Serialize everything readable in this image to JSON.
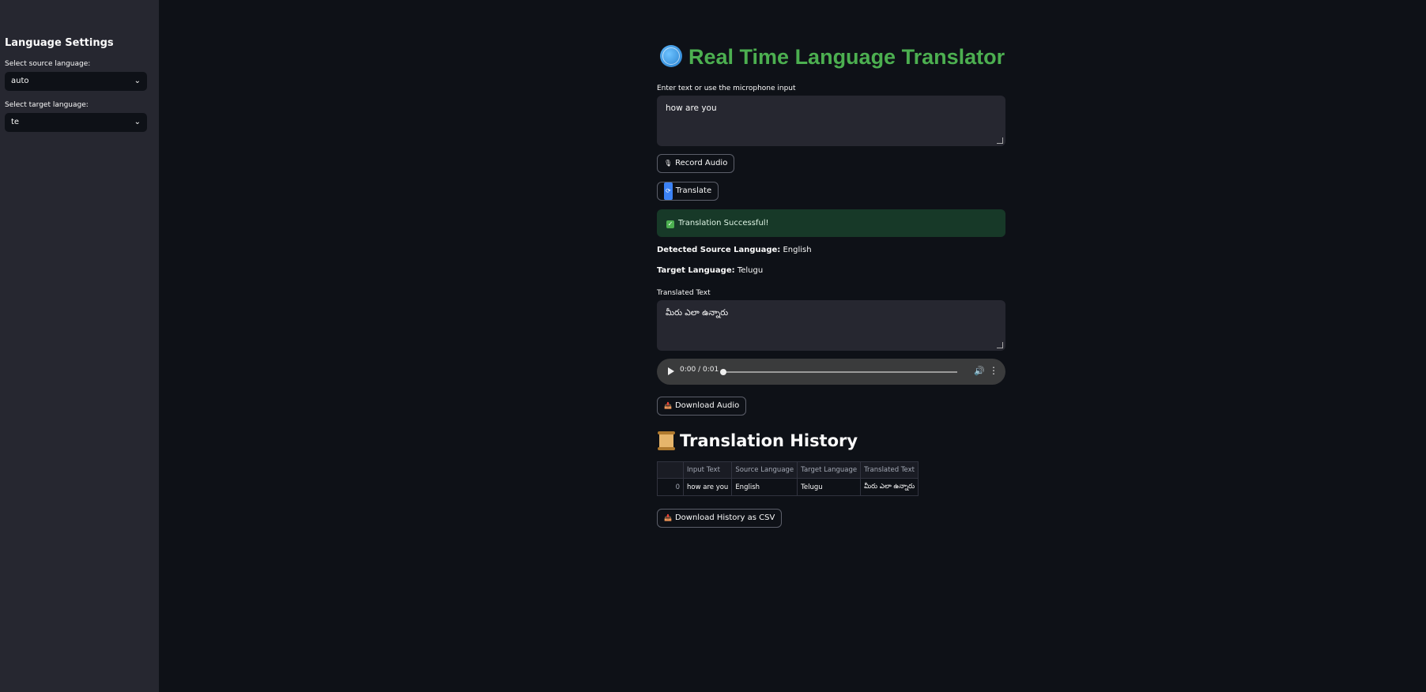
{
  "sidebar": {
    "title": "Language Settings",
    "source_label": "Select source language:",
    "source_value": "auto",
    "target_label": "Select target language:",
    "target_value": "te"
  },
  "main": {
    "title": "Real Time Language Translator",
    "input_label": "Enter text or use the microphone input",
    "input_value": "how are you",
    "record_button": "Record Audio",
    "translate_button": "Translate",
    "success_message": "Translation Successful!",
    "detected_label": "Detected Source Language:",
    "detected_value": "English",
    "target_label": "Target Language:",
    "target_value": "Telugu",
    "output_label": "Translated Text",
    "output_value": "మీరు ఎలా ఉన్నారు",
    "audio_time": "0:00 / 0:01",
    "download_audio_button": "Download Audio",
    "history_title": "Translation History",
    "history_columns": [
      "",
      "Input Text",
      "Source Language",
      "Target Language",
      "Translated Text"
    ],
    "history_rows": [
      [
        "0",
        "how are you",
        "English",
        "Telugu",
        "మీరు ఎలా ఉన్నారు"
      ]
    ],
    "download_csv_button": "Download History as CSV"
  },
  "colors": {
    "background": "#0e1117",
    "sidebar": "#262730",
    "title": "#4caf50",
    "success_bg": "#173928"
  }
}
